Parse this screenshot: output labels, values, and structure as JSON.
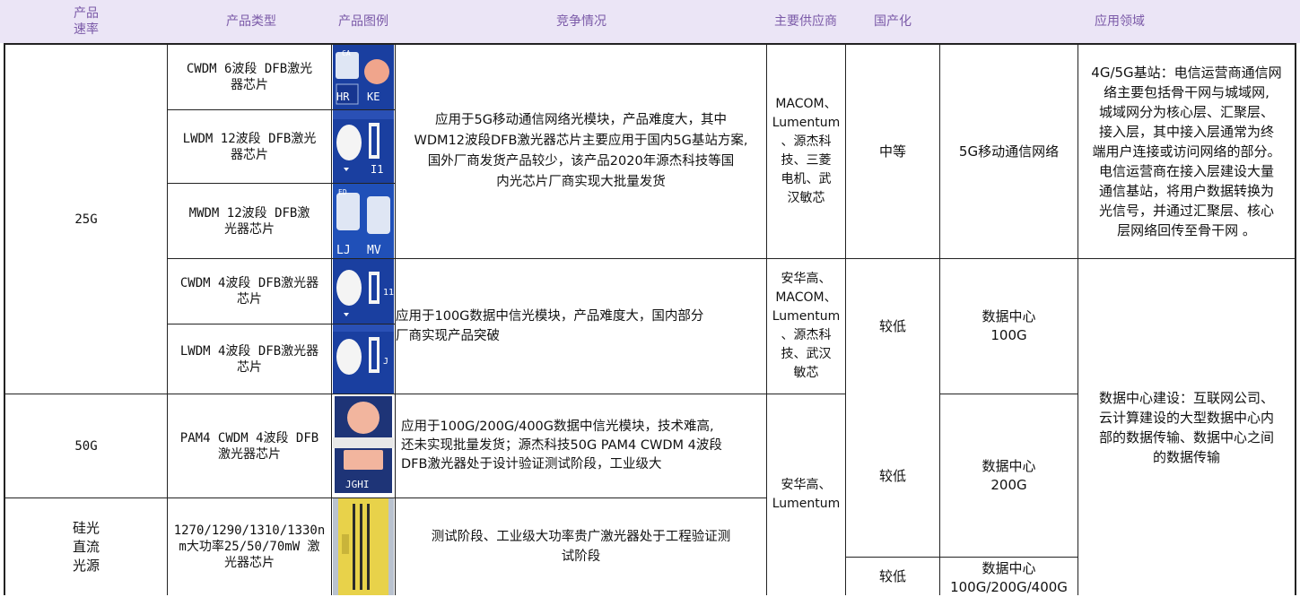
{
  "headers": {
    "rate": "产品\n速率",
    "type": "产品类型",
    "image": "产品图例",
    "competition": "竞争情况",
    "suppliers": "主要供应商",
    "localization": "国产化",
    "application": "应用领域"
  },
  "rates": {
    "r25g": "25G",
    "r50g": "50G",
    "silicon": "硅光\n直流\n光源"
  },
  "types": {
    "cwdm6": "CWDM 6波段 DFB激光\n器芯片",
    "lwdm12": "LWDM 12波段 DFB激光\n器芯片",
    "mwdm12": "MWDM 12波段 DFB激\n光器芯片",
    "cwdm4": "CWDM 4波段 DFB激光器\n芯片",
    "lwdm4": "LWDM 4波段 DFB激光器\n芯片",
    "pam4": "PAM4 CWDM 4波段 DFB\n激光器芯片",
    "silicon": "1270/1290/1310/1330n\nm大功率25/50/70mW 激\n光器芯片"
  },
  "chip_labels": {
    "chip1": [
      "CA",
      "HR",
      "KE"
    ],
    "chip2": [
      "I1"
    ],
    "chip3": [
      "ED",
      "LJ",
      "MV"
    ],
    "chip4": [
      "11"
    ],
    "chip5": [
      "J"
    ],
    "chip6": [
      "JGHI"
    ]
  },
  "competition": {
    "g1": "应用于5G移动通信网络光模块，产品难度大，其中\nWDM12波段DFB激光器芯片主要应用于国内5G基站方案,\n国外厂商发货产品较少，该产品2020年源杰科技等国\n内光芯片厂商实现大批量发货",
    "g2": "应用于100G数据中信光模块，产品难度大，国内部分\n厂商实现产品突破",
    "g3": "应用于100G/200G/400G数据中信光模块，技术难高,\n还未实现批量发货；源杰科技50G PAM4 CWDM 4波段\nDFB激光器处于设计验证测试阶段，工业级大",
    "g4": "测试阶段、工业级大功率贵广激光器处于工程验证测\n试阶段"
  },
  "suppliers": {
    "g1": "MACOM、\nLumentum\n、源杰科\n技、三菱\n电机、武\n汉敏芯",
    "g2": "安华高、\nMACOM、\nLumentum\n、源杰科\n技、武汉\n敏芯",
    "g3": "安华高、\nLumentum"
  },
  "localization": {
    "g1": "中等",
    "g2": "较低",
    "g3": "较低",
    "g4": "较低"
  },
  "network": {
    "g1": "5G移动通信网络",
    "g2": "数据中心\n100G",
    "g3": "数据中心\n200G",
    "g4": "数据中心\n100G/200G/400G"
  },
  "application": {
    "g1": "4G/5G基站：电信运营商通信网\n络主要包括骨干网与城域网,\n城域网分为核心层、汇聚层、\n接入层，其中接入层通常为终\n端用户连接或访问网络的部分。\n电信运营商在接入层建设大量\n通信基站，将用户数据转换为\n光信号，并通过汇聚层、核心\n层网络回传至骨干网 。",
    "g2": "数据中心建设：互联网公司、\n云计算建设的大型数据中心内\n部的数据传输、数据中心之间\n的数据传输"
  },
  "colors": {
    "header_bg": "#ebe5f6",
    "header_text": "#7b5aa8",
    "chip_blue": "#1a3fa0",
    "chip_pad": "#f0a58c",
    "chip_gold": "#e8d24a"
  }
}
